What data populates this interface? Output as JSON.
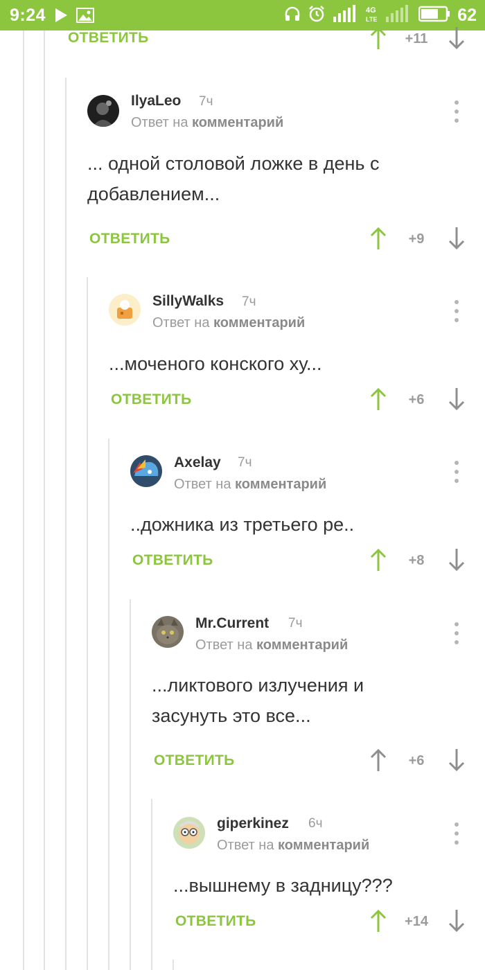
{
  "status_bar": {
    "time": "9:24",
    "battery": "62",
    "icons": [
      "play-icon",
      "image-icon",
      "headphones-icon",
      "alarm-icon",
      "signal-icon",
      "4g-lte-icon",
      "signal-weak-icon",
      "battery-icon"
    ]
  },
  "colors": {
    "brand_green": "#8cc63f",
    "thread_line": "#e2e2e2",
    "muted_text": "#9b9b9b"
  },
  "top": {
    "reply_label": "ОТВЕТИТЬ",
    "score": "+11"
  },
  "comments": [
    {
      "author": "IlyaLeo",
      "time": "7ч",
      "reply_prefix": "Ответ на",
      "reply_target": "комментарий",
      "lines": [
        "... одной столовой ложке в день с",
        "добавлением..."
      ],
      "reply_label": "ОТВЕТИТЬ",
      "score": "+9"
    },
    {
      "author": "SillyWalks",
      "time": "7ч",
      "reply_prefix": "Ответ на",
      "reply_target": "комментарий",
      "lines": [
        "...моченого конского ху..."
      ],
      "reply_label": "ОТВЕТИТЬ",
      "score": "+6"
    },
    {
      "author": "Axelay",
      "time": "7ч",
      "reply_prefix": "Ответ на",
      "reply_target": "комментарий",
      "lines": [
        "..дожника из третьего ре.."
      ],
      "reply_label": "ОТВЕТИТЬ",
      "score": "+8"
    },
    {
      "author": "Mr.Current",
      "time": "7ч",
      "reply_prefix": "Ответ на",
      "reply_target": "комментарий",
      "lines": [
        "...ликтового излучения и",
        "засунуть это все..."
      ],
      "reply_label": "ОТВЕТИТЬ",
      "score": "+6"
    },
    {
      "author": "giperkinez",
      "time": "6ч",
      "reply_prefix": "Ответ на",
      "reply_target": "комментарий",
      "lines": [
        "...вышнему в задницу???"
      ],
      "reply_label": "ОТВЕТИТЬ",
      "score": "+14"
    }
  ]
}
